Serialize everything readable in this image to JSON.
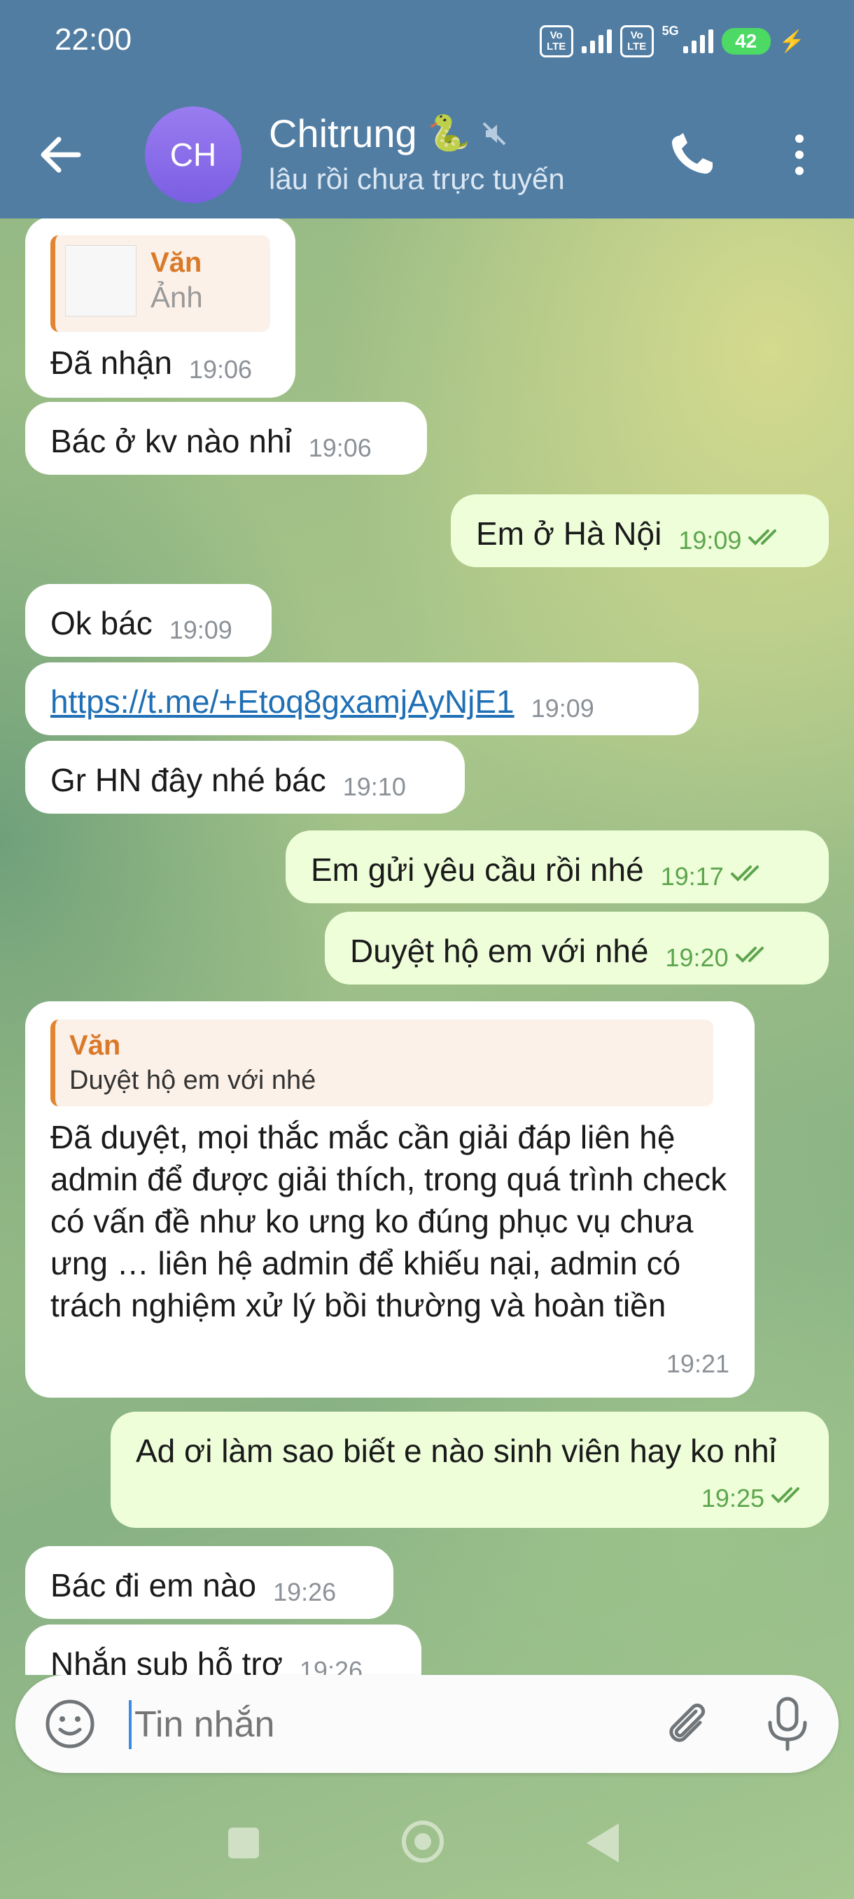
{
  "status_bar": {
    "time": "22:00",
    "volte1": "Vo LTE",
    "volte2": "Vo LTE",
    "network": "5G",
    "battery": "42"
  },
  "header": {
    "avatar_initials": "CH",
    "contact_name": "Chitrung",
    "contact_emoji": "🐍",
    "status": "lâu rồi chưa trực tuyến"
  },
  "messages": [
    {
      "dir": "in",
      "reply": {
        "name": "Văn",
        "text": "Ảnh"
      },
      "text": "Đã nhận",
      "time": "19:06"
    },
    {
      "dir": "in",
      "text": "Bác ở kv nào nhỉ",
      "time": "19:06"
    },
    {
      "dir": "out",
      "text": "Em ở Hà Nội",
      "time": "19:09"
    },
    {
      "dir": "in",
      "text": "Ok bác",
      "time": "19:09"
    },
    {
      "dir": "in",
      "text": "https://t.me/+Etoq8gxamjAyNjE1",
      "time": "19:09"
    },
    {
      "dir": "in",
      "text": "Gr HN đây nhé bác",
      "time": "19:10"
    },
    {
      "dir": "out",
      "text": "Em gửi yêu cầu rồi nhé",
      "time": "19:17"
    },
    {
      "dir": "out",
      "text": "Duyệt hộ em với nhé",
      "time": "19:20"
    },
    {
      "dir": "in",
      "reply": {
        "name": "Văn",
        "text": "Duyệt hộ em với nhé"
      },
      "text": "Đã duyệt, mọi thắc mắc cần giải đáp liên hệ admin để được giải thích, trong quá trình check có vấn đề như ko ưng ko đúng phục vụ chưa ưng … liên hệ admin để khiếu nại, admin có trách nghiệm xử lý bồi thường và hoàn tiền",
      "time": "19:21"
    },
    {
      "dir": "out",
      "text": "Ad ơi làm sao biết e nào sinh viên hay ko nhỉ",
      "time": "19:25"
    },
    {
      "dir": "in",
      "text": "Bác đi em nào",
      "time": "19:26"
    },
    {
      "dir": "in",
      "text": "Nhắn sub hỗ trợ",
      "time": "19:26"
    }
  ],
  "input": {
    "placeholder": "Tin nhắn"
  },
  "icons": {
    "back": "arrow-left-icon",
    "call": "phone-icon",
    "menu": "more-vertical-icon",
    "mute": "muted-icon",
    "emoji": "smile-icon",
    "attach": "paperclip-icon",
    "mic": "microphone-icon"
  },
  "colors": {
    "header": "#517da2",
    "outgoing_bubble": "#eefed9",
    "incoming_bubble": "#ffffff",
    "link": "#1f6fb5",
    "reply_accent": "#e08531",
    "avatar": "#8a6ceb",
    "read_ticks": "#5da54d"
  }
}
